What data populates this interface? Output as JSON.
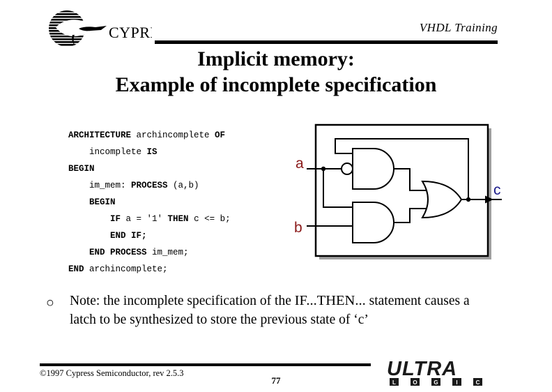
{
  "header": {
    "logo_text": "CYPRESS",
    "logo_name": "cypress-logo",
    "training_label": "VHDL Training"
  },
  "title": {
    "line1": "Implicit memory:",
    "line2": "Example of incomplete specification"
  },
  "code": {
    "language": "VHDL",
    "lines": [
      [
        {
          "t": "ARCHITECTURE",
          "b": true
        },
        {
          "t": " archincomplete ",
          "b": false
        },
        {
          "t": "OF",
          "b": true
        }
      ],
      [
        {
          "t": "    incomplete ",
          "b": false
        },
        {
          "t": "IS",
          "b": true
        }
      ],
      [
        {
          "t": "BEGIN",
          "b": true
        }
      ],
      [
        {
          "t": "    im_mem: ",
          "b": false
        },
        {
          "t": "PROCESS",
          "b": true
        },
        {
          "t": " (a,b)",
          "b": false
        }
      ],
      [
        {
          "t": "    ",
          "b": false
        },
        {
          "t": "BEGIN",
          "b": true
        }
      ],
      [
        {
          "t": "        ",
          "b": false
        },
        {
          "t": "IF",
          "b": true
        },
        {
          "t": " a = '1' ",
          "b": false
        },
        {
          "t": "THEN",
          "b": true
        },
        {
          "t": " c <= b;",
          "b": false
        }
      ],
      [
        {
          "t": "        ",
          "b": false
        },
        {
          "t": "END IF;",
          "b": true
        }
      ],
      [
        {
          "t": "    ",
          "b": false
        },
        {
          "t": "END PROCESS",
          "b": true
        },
        {
          "t": " im_mem;",
          "b": false
        }
      ],
      [
        {
          "t": "END",
          "b": true
        },
        {
          "t": " archincomplete;",
          "b": false
        }
      ]
    ]
  },
  "schematic": {
    "title": "inferred-latch-circuit",
    "signals": {
      "a": "a",
      "b": "b",
      "c": "c"
    },
    "colors": {
      "input_label": "#8b1a1a",
      "output_label": "#1a1a8b",
      "wire": "#000000",
      "shadow": "#a0a0a0"
    },
    "gates": [
      {
        "name": "and-gate-top",
        "type": "AND",
        "inverted_input": true
      },
      {
        "name": "and-gate-bottom",
        "type": "AND",
        "inverted_input": false
      },
      {
        "name": "or-gate",
        "type": "OR",
        "inverted_input": false
      }
    ]
  },
  "note": {
    "bullet": "○",
    "part1": "Note: the incomplete specification of the ",
    "keyword": "IF...THEN...",
    "part2": " statement causes a latch to be synthesized to store the previous state of ‘c’"
  },
  "footer": {
    "copyright": "©1997 Cypress Semiconductor, rev 2.5.3",
    "page_number": "77",
    "brand_primary": "ULTRA",
    "brand_letters": [
      "L",
      "O",
      "G",
      "I",
      "C"
    ]
  }
}
